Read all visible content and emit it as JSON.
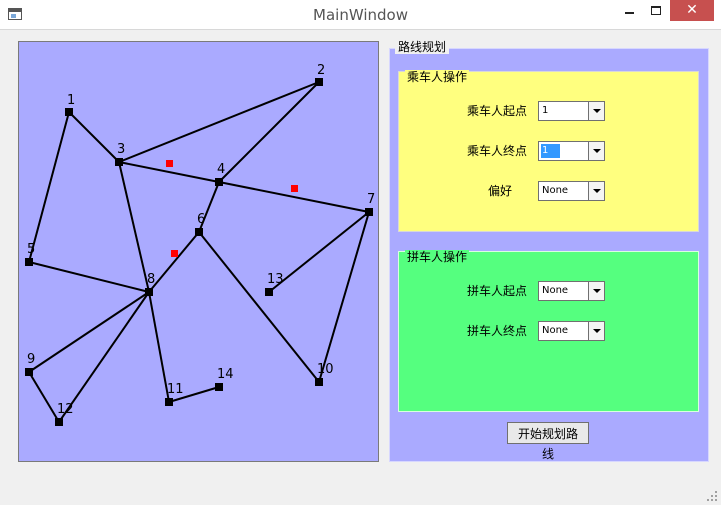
{
  "window": {
    "title": "MainWindow",
    "close_glyph": "✕",
    "icons": [
      "app-icon",
      "minimize-icon",
      "maximize-icon",
      "close-icon"
    ]
  },
  "map": {
    "background": "#aaaaff",
    "nodes": [
      {
        "id": "1",
        "label": "1"
      },
      {
        "id": "2",
        "label": "2"
      },
      {
        "id": "3",
        "label": "3"
      },
      {
        "id": "4",
        "label": "4"
      },
      {
        "id": "5",
        "label": "5"
      },
      {
        "id": "6",
        "label": "6"
      },
      {
        "id": "7",
        "label": "7"
      },
      {
        "id": "8",
        "label": "8"
      },
      {
        "id": "9",
        "label": "9"
      },
      {
        "id": "10",
        "label": "10"
      },
      {
        "id": "11",
        "label": "11"
      },
      {
        "id": "12",
        "label": "12"
      },
      {
        "id": "13",
        "label": "13"
      },
      {
        "id": "14",
        "label": "14"
      }
    ],
    "edges": [
      [
        "1",
        "3"
      ],
      [
        "1",
        "5"
      ],
      [
        "3",
        "2"
      ],
      [
        "3",
        "4"
      ],
      [
        "2",
        "4"
      ],
      [
        "4",
        "7"
      ],
      [
        "4",
        "6"
      ],
      [
        "3",
        "8"
      ],
      [
        "5",
        "8"
      ],
      [
        "6",
        "8"
      ],
      [
        "6",
        "10"
      ],
      [
        "7",
        "10"
      ],
      [
        "7",
        "13"
      ],
      [
        "8",
        "9"
      ],
      [
        "8",
        "12"
      ],
      [
        "9",
        "12"
      ],
      [
        "8",
        "11"
      ],
      [
        "11",
        "14"
      ]
    ],
    "markers": [
      "red-marker-a",
      "red-marker-b",
      "red-marker-c"
    ],
    "marker_color": "#ff0000",
    "node_color": "#000000"
  },
  "route_planning": {
    "title": "路线规划",
    "passenger": {
      "title": "乘车人操作",
      "start_label": "乘车人起点",
      "start_value": "1",
      "end_label": "乘车人终点",
      "end_value": "1",
      "preference_label": "偏好",
      "preference_value": "None",
      "color": "#ffff7f"
    },
    "carpool": {
      "title": "拼车人操作",
      "start_label": "拼车人起点",
      "start_value": "None",
      "end_label": "拼车人终点",
      "end_value": "None",
      "color": "#55ff7f"
    },
    "start_button": "开始规划路线"
  }
}
